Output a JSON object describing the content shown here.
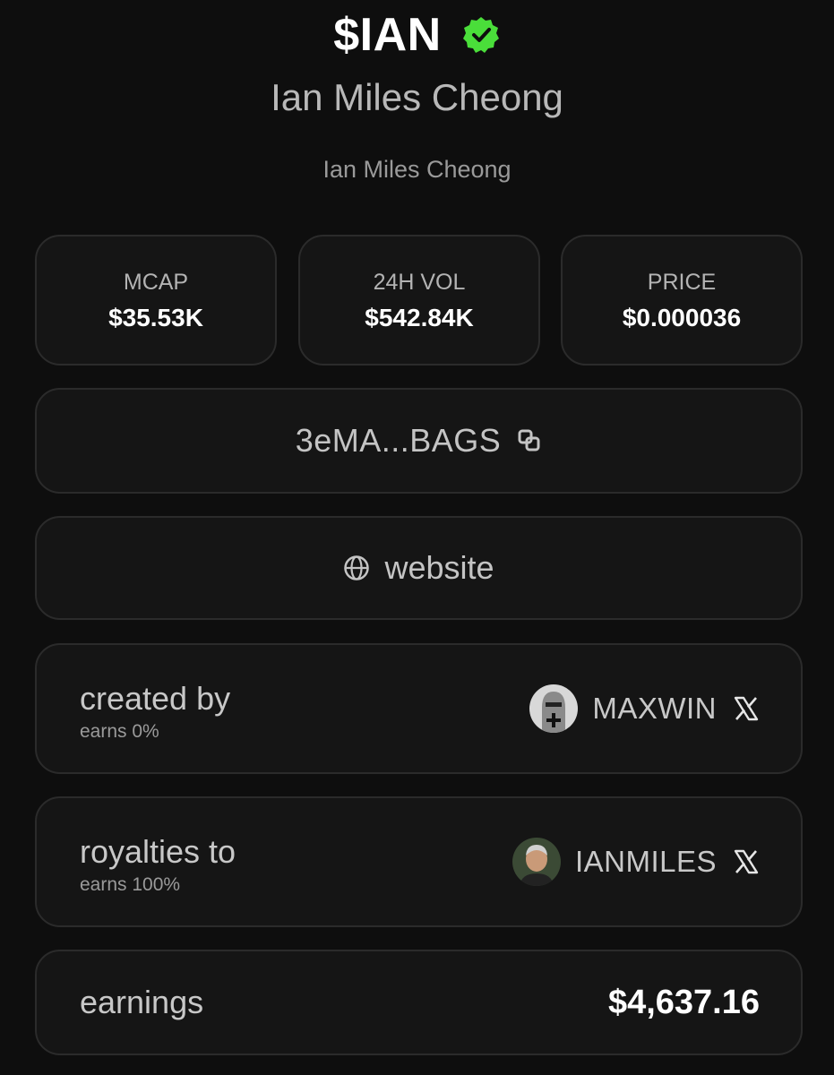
{
  "header": {
    "ticker": "$IAN",
    "verified_icon": "verified-badge-icon",
    "verified_color": "#4ade3a",
    "name": "Ian Miles Cheong",
    "description": "Ian Miles Cheong"
  },
  "stats": [
    {
      "label": "MCAP",
      "value": "$35.53K"
    },
    {
      "label": "24H VOL",
      "value": "$542.84K"
    },
    {
      "label": "PRICE",
      "value": "$0.000036"
    }
  ],
  "contract": {
    "address": "3eMA...BAGS",
    "icon": "copy-icon"
  },
  "website": {
    "label": "website",
    "icon": "globe-icon"
  },
  "created_by": {
    "title": "created by",
    "earns": "earns 0%",
    "username": "MAXWIN",
    "social_icon": "x-logo-icon"
  },
  "royalties_to": {
    "title": "royalties to",
    "earns": "earns 100%",
    "username": "IANMILES",
    "social_icon": "x-logo-icon"
  },
  "earnings": {
    "label": "earnings",
    "value": "$4,637.16"
  },
  "colors": {
    "background": "#0e0e0e",
    "card": "#151515",
    "border": "#2b2b2b",
    "accent_green": "#4ade3a"
  }
}
